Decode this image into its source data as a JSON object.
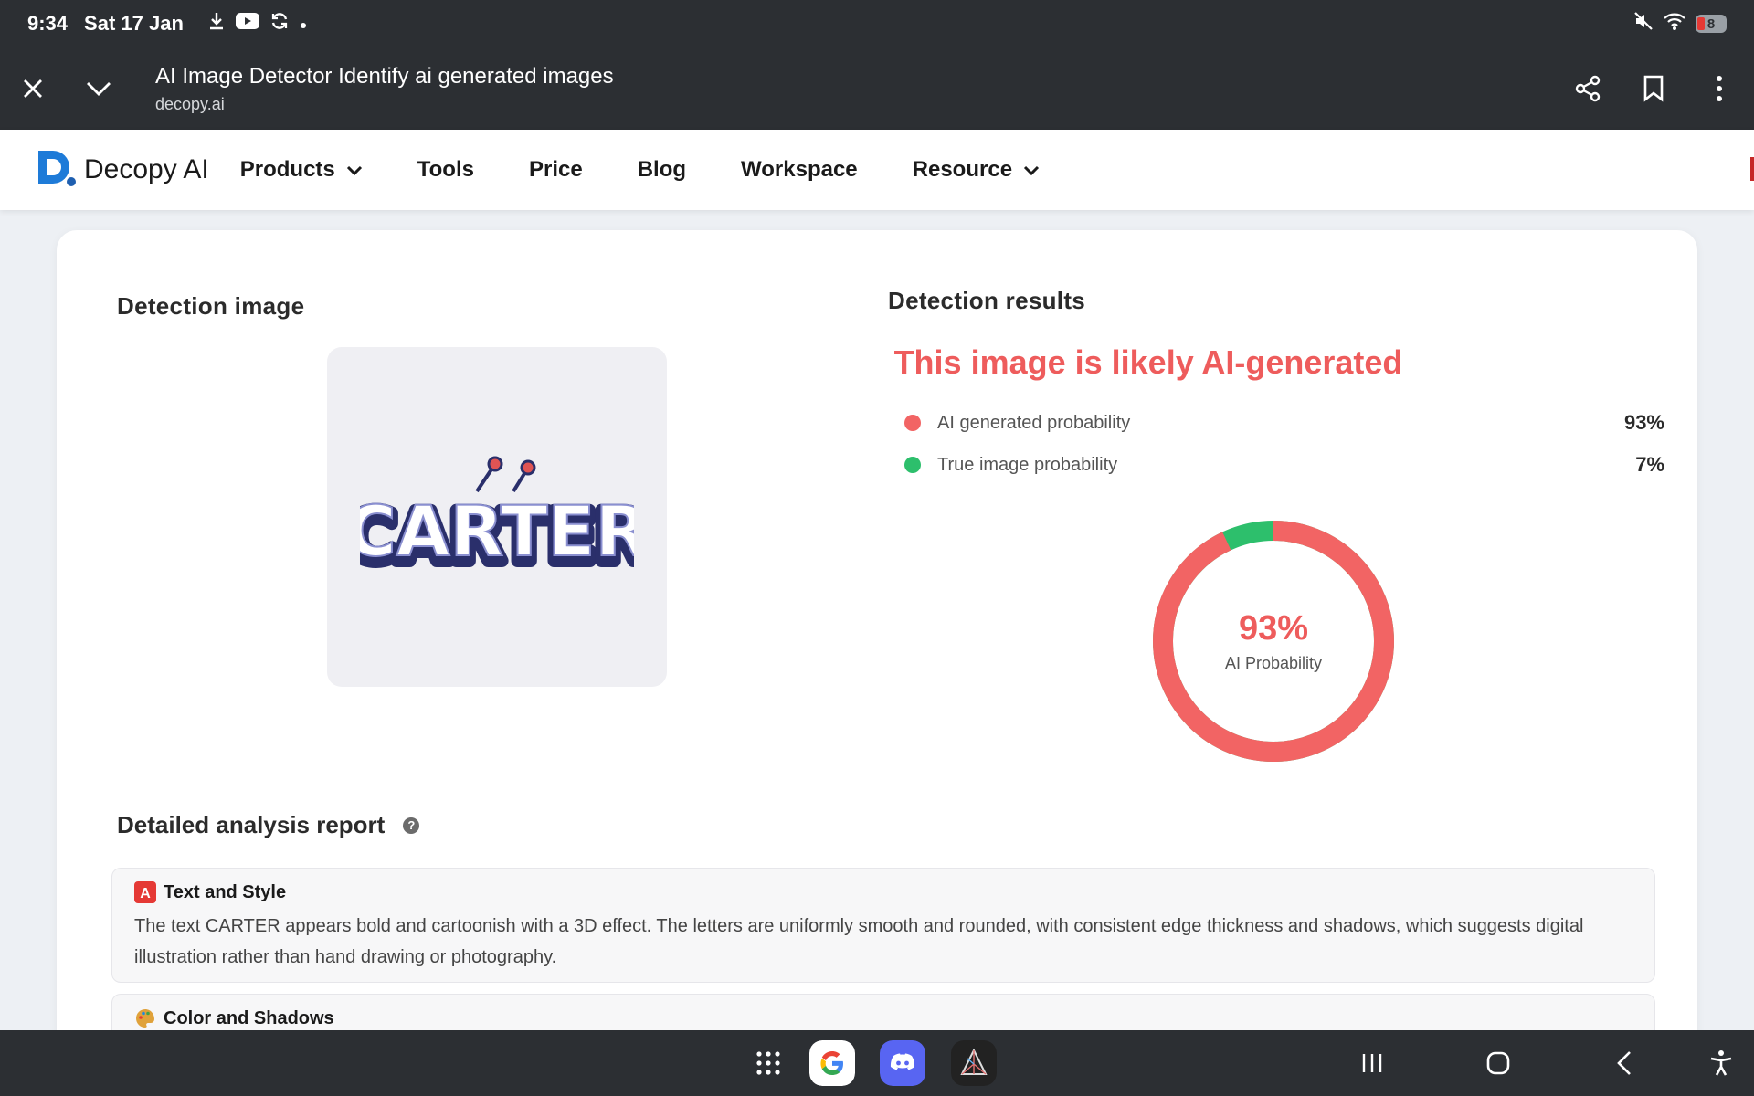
{
  "status_bar": {
    "time": "9:34",
    "date": "Sat 17 Jan",
    "battery": "8",
    "icons": [
      "download-icon",
      "youtube-icon",
      "sync-icon",
      "dot-icon",
      "mute-icon",
      "wifi-icon",
      "battery-icon"
    ]
  },
  "toolbar": {
    "title": "AI Image Detector Identify ai generated images",
    "url": "decopy.ai"
  },
  "site_nav": {
    "logo_text": "Decopy AI",
    "items": [
      {
        "label": "Products",
        "has_dropdown": true
      },
      {
        "label": "Tools",
        "has_dropdown": false
      },
      {
        "label": "Price",
        "has_dropdown": false
      },
      {
        "label": "Blog",
        "has_dropdown": false
      },
      {
        "label": "Workspace",
        "has_dropdown": false
      },
      {
        "label": "Resource",
        "has_dropdown": true
      }
    ]
  },
  "detection": {
    "image_heading": "Detection image",
    "image_word": "CARTER",
    "results_heading": "Detection results",
    "verdict": "This image is likely AI-generated",
    "ai_label": "AI generated probability",
    "ai_value": "93%",
    "true_label": "True image probability",
    "true_value": "7%",
    "donut_pct": "93%",
    "donut_label": "AI Probability",
    "ai_fraction": 0.93,
    "colors": {
      "ai": "#f26464",
      "true": "#2dbf6c",
      "accent": "#ee5c5c"
    }
  },
  "report": {
    "title": "Detailed analysis report",
    "items": [
      {
        "title": "Text and Style",
        "text": "The text CARTER appears bold and cartoonish with a 3D effect. The letters are uniformly smooth and rounded, with consistent edge thickness and shadows, which suggests digital illustration rather than hand drawing or photography."
      },
      {
        "title": "Color and Shadows",
        "text": ""
      }
    ]
  },
  "navbar": {
    "apps": [
      "app-drawer-icon",
      "google-app-icon",
      "discord-app-icon",
      "prism-app-icon"
    ],
    "buttons": [
      "recents-icon",
      "home-icon",
      "back-icon",
      "accessibility-icon"
    ]
  }
}
